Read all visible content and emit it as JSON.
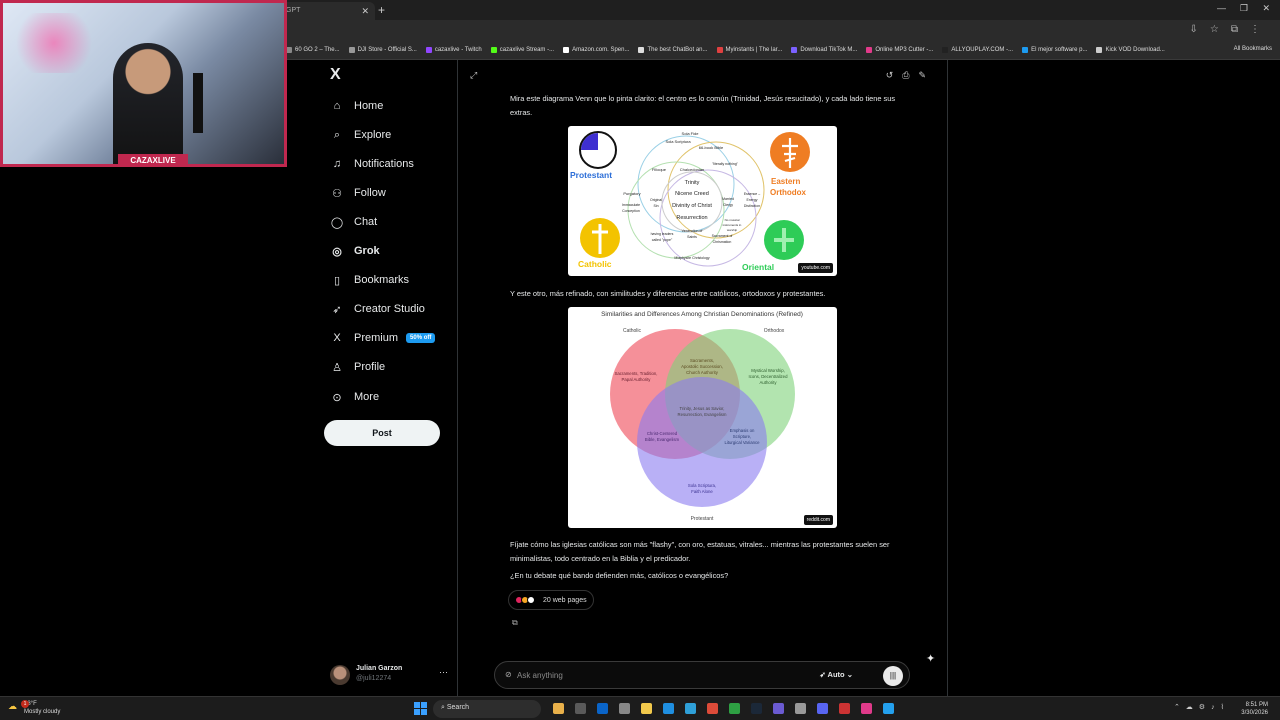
{
  "browser": {
    "active_tab_title": "GPT",
    "bookmarks": [
      {
        "label": "60 GO 2 – The...",
        "color": "#888888"
      },
      {
        "label": "DJI Store - Official S...",
        "color": "#999999"
      },
      {
        "label": "cazaxlive - Twitch",
        "color": "#9146ff"
      },
      {
        "label": "cazaxlive Stream -...",
        "color": "#53fc18"
      },
      {
        "label": "Amazon.com. Spen...",
        "color": "#ffffff"
      },
      {
        "label": "The best ChatBot an...",
        "color": "#dddddd"
      },
      {
        "label": "Myinstants | The lar...",
        "color": "#e04040"
      },
      {
        "label": "Download TikTok M...",
        "color": "#7b61ff"
      },
      {
        "label": "Online MP3 Cutter -...",
        "color": "#e23a8a"
      },
      {
        "label": "ALLYOUPLAY.COM -...",
        "color": "#222222"
      },
      {
        "label": "El mejor software p...",
        "color": "#1d9bf0"
      },
      {
        "label": "Kick VOD Download...",
        "color": "#cccccc"
      }
    ],
    "all_bookmarks": "All Bookmarks"
  },
  "webcam": {
    "label": "CAZAXLIVE"
  },
  "nav": {
    "logo": "X",
    "items": [
      {
        "label": "Home",
        "icon": "home-icon",
        "glyph": "⌂"
      },
      {
        "label": "Explore",
        "icon": "search-icon",
        "glyph": "⌕"
      },
      {
        "label": "Notifications",
        "icon": "bell-icon",
        "glyph": "♫"
      },
      {
        "label": "Follow",
        "icon": "follow-icon",
        "glyph": "⚇"
      },
      {
        "label": "Chat",
        "icon": "chat-icon",
        "glyph": "◯"
      },
      {
        "label": "Grok",
        "icon": "grok-icon",
        "glyph": "◎"
      },
      {
        "label": "Bookmarks",
        "icon": "bookmark-icon",
        "glyph": "▯"
      },
      {
        "label": "Creator Studio",
        "icon": "rocket-icon",
        "glyph": "➶"
      },
      {
        "label": "Premium",
        "icon": "x-premium-icon",
        "glyph": "X"
      },
      {
        "label": "Profile",
        "icon": "person-icon",
        "glyph": "♙"
      },
      {
        "label": "More",
        "icon": "more-circle-icon",
        "glyph": "⊙"
      }
    ],
    "premium_badge": "50% off",
    "post_label": "Post"
  },
  "profile": {
    "name": "Julian Garzon",
    "handle": "@juli12274",
    "more": "···"
  },
  "grok": {
    "para1": "Mira este diagrama Venn que lo pinta clarito: el centro es lo común (Trinidad, Jesús resucitado), y cada lado tiene sus extras.",
    "venn1": {
      "left_top": "Protestant",
      "right_top_1": "Eastern",
      "right_top_2": "Orthodox",
      "left_bottom": "Catholic",
      "right_bottom": "Oriental",
      "center": [
        "Trinity",
        "Nicene Creed",
        "Divinity of Christ",
        "Resurrection"
      ],
      "labels": {
        "sola_fide": "Sola Fide",
        "sola_scriptura": "Sola Scriptura",
        "bible": "66-book Bible",
        "chalcedonian": "Chalcedonian",
        "filioque": "Filioque",
        "literally_nothing": "\"literally nothing\"",
        "purgatory": "Purgatory",
        "immaculate": "Immaculate",
        "conception": "Conception",
        "original": "Original",
        "sin": "Sin",
        "married": "Married",
        "clergy": "Clergy",
        "essence": "Essence –",
        "energy": "Energy",
        "distinction": "Distinction",
        "no_musical": "No musical",
        "instruments": "instruments in",
        "worship": "worship",
        "having_leaders": "having leaders",
        "called_pope": "called \"pope\"",
        "veneration": "Veneration of",
        "saints": "Saints",
        "sacrament": "Sacrament of",
        "chrismation": "Chrismation",
        "miaphysite": "Miaphysite Christology"
      },
      "source": "youtube.com"
    },
    "para2": "Y este otro, más refinado, con similitudes y diferencias entre católicos, ortodoxos y protestantes.",
    "venn2": {
      "title": "Similarities and Differences Among Christian Denominations (Refined)",
      "set_catholic": "Catholic",
      "set_orthodox": "Orthodox",
      "set_protestant": "Protestant",
      "catholic_only": [
        "Sacraments, Tradition,",
        "Papal Authority"
      ],
      "orthodox_only": [
        "Mystical Worship,",
        "Icons, Decentralized",
        "Authority"
      ],
      "protestant_only": [
        "Sola Scriptura,",
        "Faith Alone"
      ],
      "cath_orth": [
        "Sacraments,",
        "Apostolic Succession,",
        "Church Authority"
      ],
      "cath_prot": [
        "Christ-Centered",
        "Bible, Evangelism"
      ],
      "orth_prot": [
        "Emphasis on",
        "Scripture,",
        "Liturgical Variance"
      ],
      "all_three": [
        "Trinity, Jesus as Savior,",
        "Resurrection, Evangelism"
      ],
      "source": "reddit.com",
      "colors": {
        "catholic": "#f26b77",
        "orthodox": "#7ed27a",
        "protestant": "#8b7bf0"
      }
    },
    "para3": "Fíjate cómo las iglesias católicas son más \"flashy\", con oro, estatuas, vitrales... mientras las protestantes suelen ser minimalistas, todo centrado en la Biblia y el predicador.",
    "para4": "¿En tu debate qué bando defienden más, católicos o evangélicos?",
    "sources_label": "20 web pages",
    "ask_placeholder": "Ask anything",
    "mode_label": "Auto"
  },
  "taskbar": {
    "temp": "68°F",
    "weather": "Mostly cloudy",
    "notif_count": "1",
    "search_label": "Search",
    "time": "8:51 PM",
    "date": "3/30/2026"
  }
}
